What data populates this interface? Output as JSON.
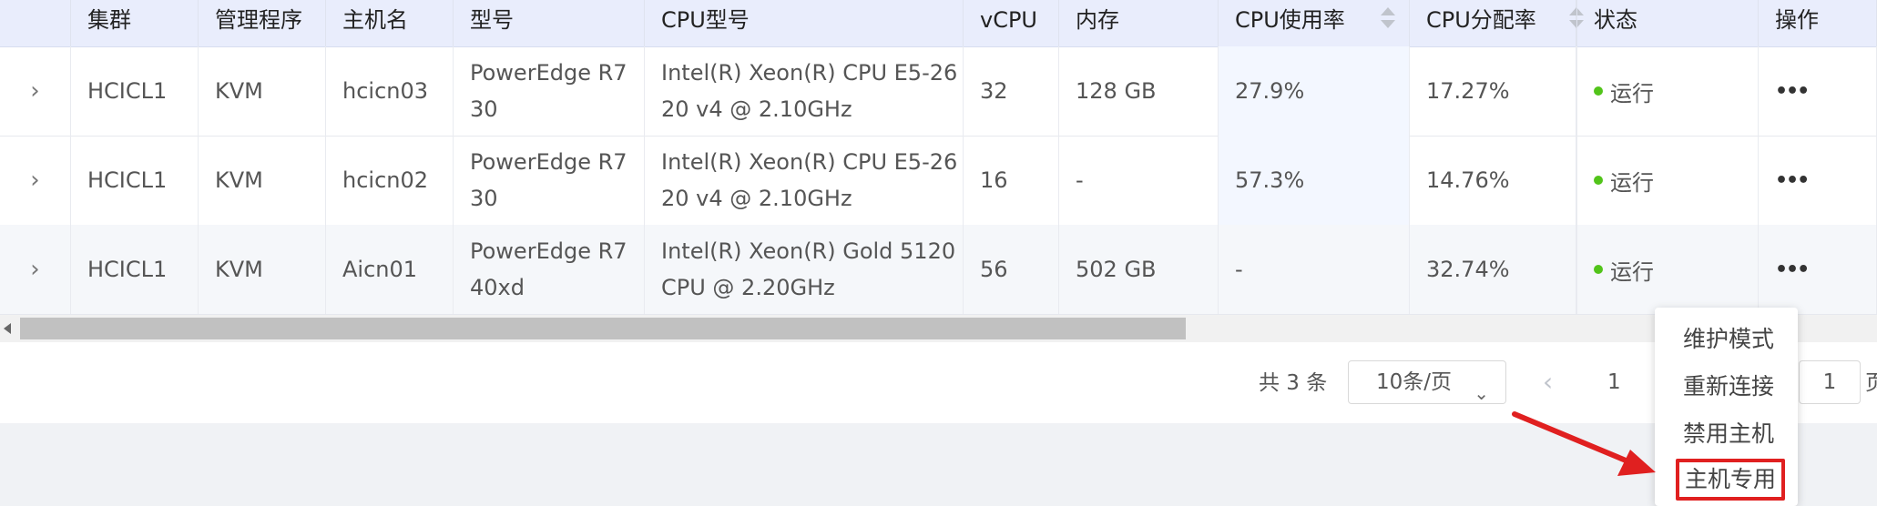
{
  "columns": [
    "集群",
    "管理程序",
    "主机名",
    "型号",
    "CPU型号",
    "vCPU",
    "内存",
    "CPU使用率",
    "CPU分配率",
    "状态",
    "操作"
  ],
  "rows": [
    {
      "cluster": "HCICL1",
      "hypervisor": "KVM",
      "hostname": "hcicn03",
      "model_l1": "PowerEdge R7",
      "model_l2": "30",
      "cpu_l1": "Intel(R) Xeon(R) CPU E5-26",
      "cpu_l2": "20 v4 @ 2.10GHz",
      "vcpu": "32",
      "memory": "128 GB",
      "cpu_usage": "27.9%",
      "cpu_alloc": "17.27%",
      "status": "运行"
    },
    {
      "cluster": "HCICL1",
      "hypervisor": "KVM",
      "hostname": "hcicn02",
      "model_l1": "PowerEdge R7",
      "model_l2": "30",
      "cpu_l1": "Intel(R) Xeon(R) CPU E5-26",
      "cpu_l2": "20 v4 @ 2.10GHz",
      "vcpu": "16",
      "memory": "-",
      "cpu_usage": "57.3%",
      "cpu_alloc": "14.76%",
      "status": "运行"
    },
    {
      "cluster": "HCICL1",
      "hypervisor": "KVM",
      "hostname": "Aicn01",
      "model_l1": "PowerEdge R7",
      "model_l2": "40xd",
      "cpu_l1": "Intel(R) Xeon(R) Gold 5120",
      "cpu_l2": "CPU @ 2.20GHz",
      "vcpu": "56",
      "memory": "502 GB",
      "cpu_usage": "-",
      "cpu_alloc": "32.74%",
      "status": "运行"
    }
  ],
  "icons": {
    "expand": "chevron-right-icon",
    "more": "more-icon",
    "sort": "sort-icon",
    "status": "status-dot-icon"
  },
  "more_glyph": "•••",
  "expand_glyph": "›",
  "pagination": {
    "total": "共 3 条",
    "page_size": "10条/页",
    "current_page": "1",
    "jump_value": "1",
    "jump_suffix": "页",
    "prev_glyph": "‹",
    "select_glyph": "⌄"
  },
  "dropdown_menu": [
    "维护模式",
    "重新连接",
    "禁用主机",
    "主机专用"
  ],
  "colors": {
    "header_bg": "#e9edfc",
    "status_running": "#52c41a",
    "annotation_red": "#e02020"
  }
}
